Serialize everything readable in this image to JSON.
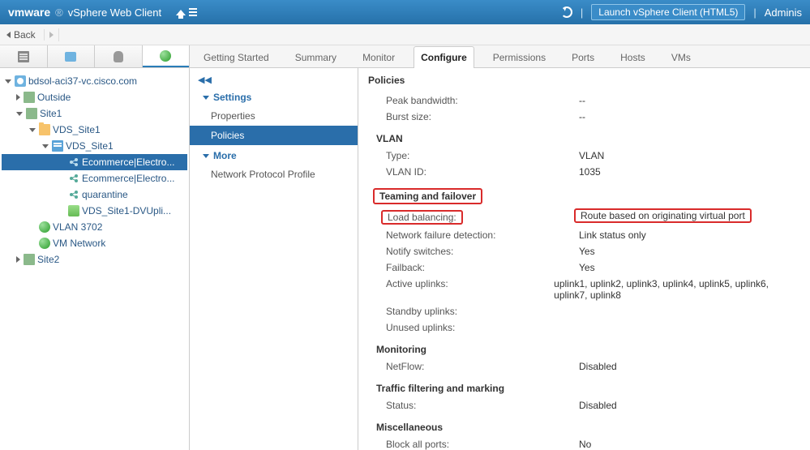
{
  "topbar": {
    "brand_vm": "vmware",
    "brand_rest": "vSphere Web Client",
    "launch_label": "Launch vSphere Client (HTML5)",
    "user_label": "Adminis"
  },
  "backbar": {
    "back_label": "Back"
  },
  "tree": {
    "root": "bdsol-aci37-vc.cisco.com",
    "outside": "Outside",
    "site1": "Site1",
    "vds_folder": "VDS_Site1",
    "vds_switch": "VDS_Site1",
    "pg_selected": "Ecommerce|Electro...",
    "pg2": "Ecommerce|Electro...",
    "pg_quarantine": "quarantine",
    "dvuplink": "VDS_Site1-DVUpli...",
    "vlan3702": "VLAN 3702",
    "vmnetwork": "VM Network",
    "site2": "Site2"
  },
  "tabs": {
    "getting_started": "Getting Started",
    "summary": "Summary",
    "monitor": "Monitor",
    "configure": "Configure",
    "permissions": "Permissions",
    "ports": "Ports",
    "hosts": "Hosts",
    "vms": "VMs"
  },
  "config_nav": {
    "collapse": "◀◀",
    "settings_group": "Settings",
    "properties": "Properties",
    "policies": "Policies",
    "more_group": "More",
    "npp": "Network Protocol Profile"
  },
  "details": {
    "title": "Policies",
    "peak_bw_k": "Peak bandwidth:",
    "peak_bw_v": "--",
    "burst_k": "Burst size:",
    "burst_v": "--",
    "vlan_h": "VLAN",
    "vlan_type_k": "Type:",
    "vlan_type_v": "VLAN",
    "vlan_id_k": "VLAN ID:",
    "vlan_id_v": "1035",
    "teaming_h": "Teaming and failover",
    "lb_k": "Load balancing:",
    "lb_v": "Route based on originating virtual port",
    "nfd_k": "Network failure detection:",
    "nfd_v": "Link status only",
    "notify_k": "Notify switches:",
    "notify_v": "Yes",
    "failback_k": "Failback:",
    "failback_v": "Yes",
    "active_k": "Active uplinks:",
    "active_v": "uplink1, uplink2, uplink3, uplink4, uplink5, uplink6, uplink7, uplink8",
    "standby_k": "Standby uplinks:",
    "standby_v": "",
    "unused_k": "Unused uplinks:",
    "unused_v": "",
    "monitoring_h": "Monitoring",
    "netflow_k": "NetFlow:",
    "netflow_v": "Disabled",
    "tfm_h": "Traffic filtering and marking",
    "status_k": "Status:",
    "status_v": "Disabled",
    "misc_h": "Miscellaneous",
    "block_k": "Block all ports:",
    "block_v": "No"
  }
}
